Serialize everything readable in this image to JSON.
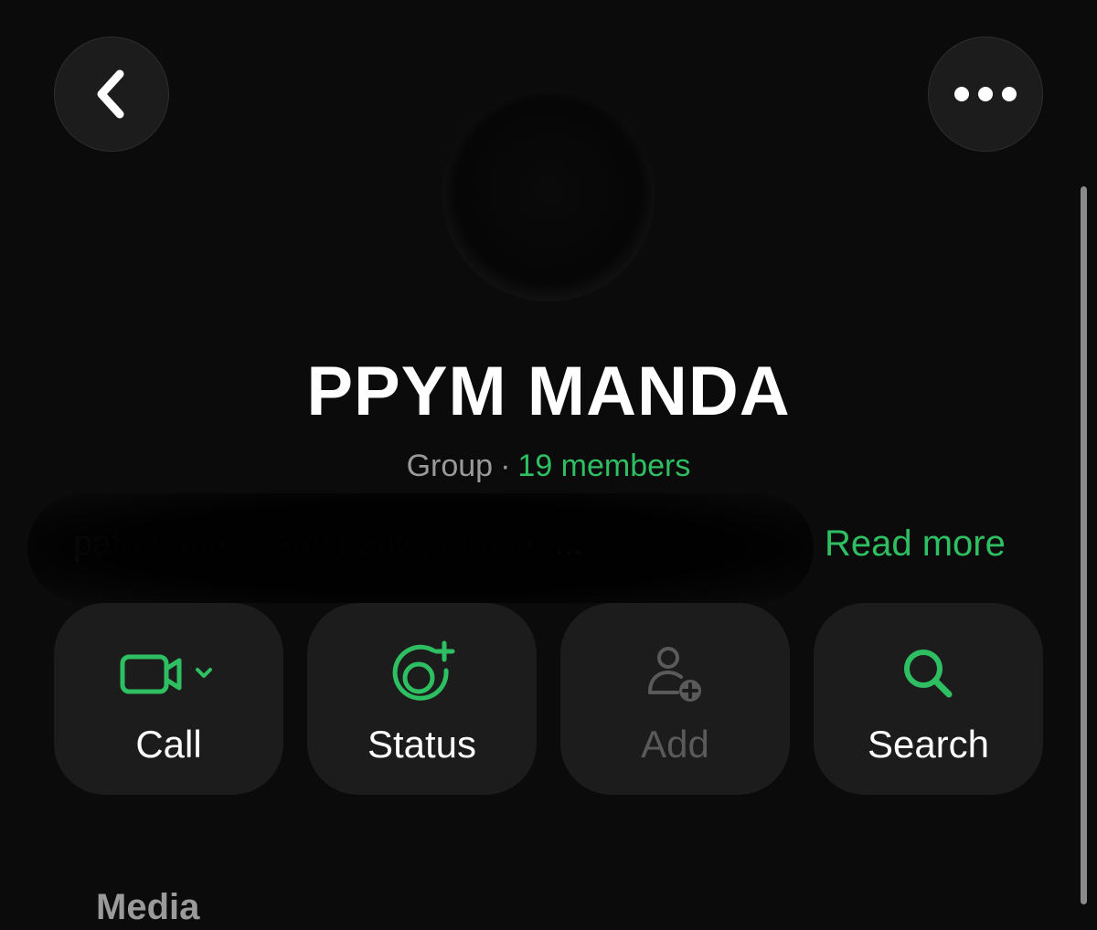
{
  "header": {
    "back_icon": "chevron-left-icon",
    "more_icon": "ellipsis-icon"
  },
  "profile": {
    "name": "PPYM MANDA",
    "type": "Group",
    "separator": "·",
    "members": "19 members",
    "description": "pato tomas santi bauti juan san",
    "ellipsis": "...",
    "read_more": "Read more"
  },
  "actions": [
    {
      "label": "Call",
      "icon": "video-camera-icon",
      "enabled": true
    },
    {
      "label": "Status",
      "icon": "status-add-icon",
      "enabled": true
    },
    {
      "label": "Add",
      "icon": "add-person-icon",
      "enabled": false
    },
    {
      "label": "Search",
      "icon": "search-icon",
      "enabled": true
    }
  ],
  "sections": {
    "media_title": "Media"
  },
  "colors": {
    "accent": "#2fbf63",
    "background": "#0b0b0b",
    "card": "#1c1c1c",
    "muted": "#9a9a9a",
    "disabled": "#5a5a5a"
  }
}
